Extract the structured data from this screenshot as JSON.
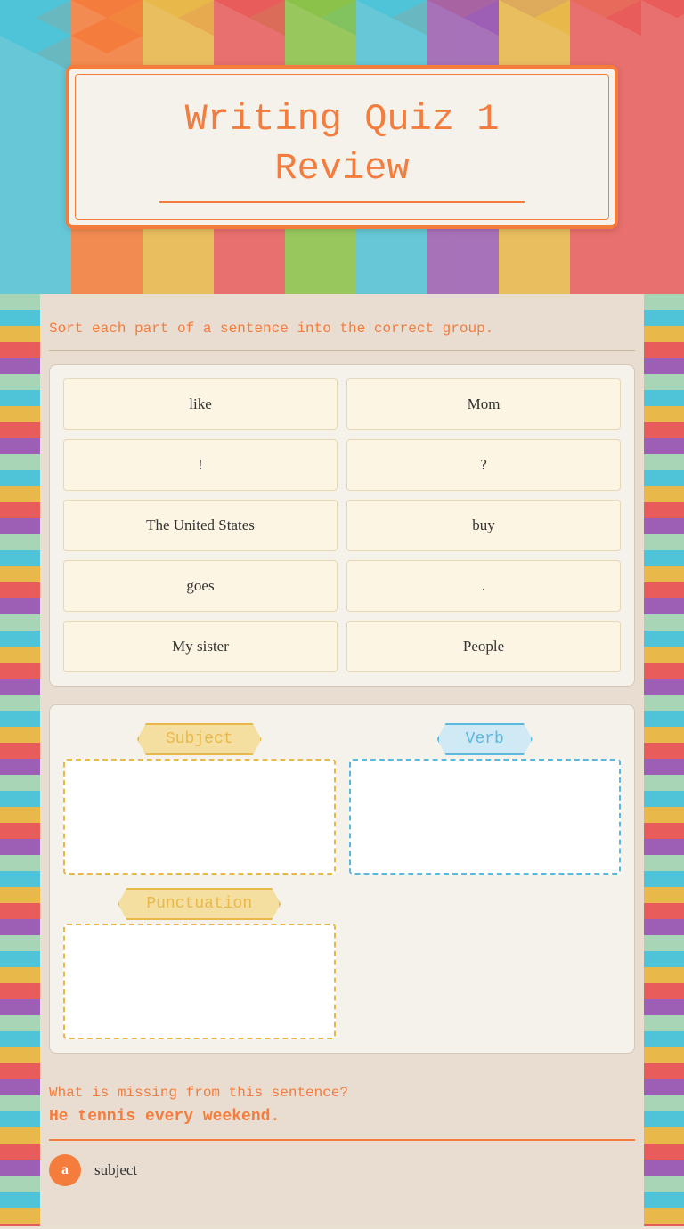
{
  "title": {
    "line1": "Writing Quiz 1",
    "line2": "Review"
  },
  "instruction": "Sort each part of a sentence into the correct group.",
  "sort_items": [
    {
      "id": "like",
      "text": "like"
    },
    {
      "id": "mom",
      "text": "Mom"
    },
    {
      "id": "exclamation",
      "text": "!"
    },
    {
      "id": "question",
      "text": "?"
    },
    {
      "id": "united_states",
      "text": "The United States"
    },
    {
      "id": "buy",
      "text": "buy"
    },
    {
      "id": "goes",
      "text": "goes"
    },
    {
      "id": "period",
      "text": "."
    },
    {
      "id": "my_sister",
      "text": "My sister"
    },
    {
      "id": "people",
      "text": "People"
    }
  ],
  "groups": {
    "subject": {
      "label": "Subject"
    },
    "verb": {
      "label": "Verb"
    },
    "punctuation": {
      "label": "Punctuation"
    }
  },
  "question_section": {
    "label": "What is missing from this sentence?",
    "sentence": "He tennis every weekend.",
    "option_a": {
      "letter": "a",
      "text": "subject"
    }
  }
}
